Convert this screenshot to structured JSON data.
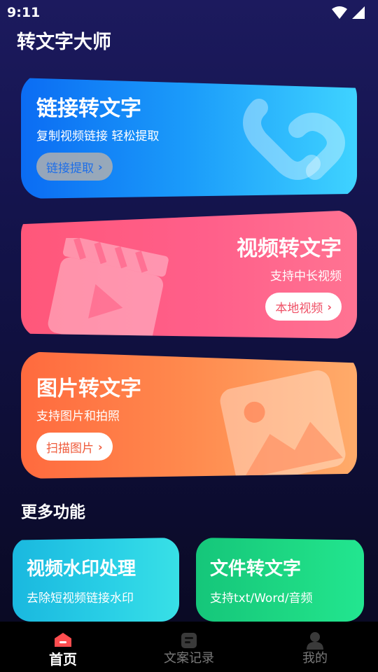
{
  "status": {
    "time": "9:11"
  },
  "app": {
    "title": "转文字大师"
  },
  "cards": {
    "link": {
      "title": "链接转文字",
      "subtitle": "复制视频链接 轻松提取",
      "button": "链接提取"
    },
    "video": {
      "title": "视频转文字",
      "subtitle": "支持中长视频",
      "button": "本地视频"
    },
    "image": {
      "title": "图片转文字",
      "subtitle": "支持图片和拍照",
      "button": "扫描图片"
    }
  },
  "more": {
    "title": "更多功能",
    "watermark": {
      "title": "视频水印处理",
      "subtitle": "去除短视频链接水印"
    },
    "file": {
      "title": "文件转文字",
      "subtitle": "支持txt/Word/音频"
    }
  },
  "nav": {
    "home": "首页",
    "records": "文案记录",
    "mine": "我的"
  },
  "colors": {
    "link_card": "#1b9cfa",
    "video_card": "#ff5f8a",
    "image_card": "#ff8a4e",
    "watermark_card": "#2ad0e6",
    "file_card": "#1ed984",
    "nav_active_icon": "#ff4d4f"
  }
}
